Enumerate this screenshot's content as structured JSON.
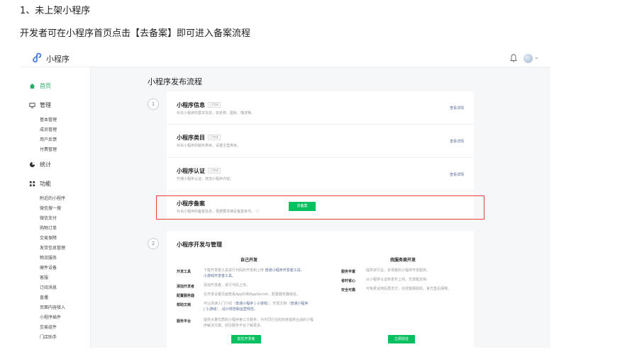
{
  "doc": {
    "heading": "1、未上架小程序",
    "line": "开发者可在小程序首页点击【去备案】即可进入备案流程"
  },
  "app": {
    "title": "小程序"
  },
  "sidebar": {
    "home": "首页",
    "manage": "管理",
    "manage_items": [
      "基本管理",
      "成员管理",
      "用户反馈",
      "付费管理"
    ],
    "stats": "统计",
    "features": "功能",
    "feature_items": [
      "附近的小程序",
      "微信搜一搜",
      "微信支付",
      "购物订单",
      "交易保障",
      "发货信息管理",
      "物流服务",
      "硬件设备",
      "客服",
      "订阅消息",
      "直播",
      "页面内容接入",
      "小程序插件",
      "交易组件",
      "门店助手"
    ]
  },
  "main": {
    "title": "小程序发布流程",
    "step1": "1",
    "step2": "2",
    "rows": [
      {
        "title": "小程序信息",
        "badge": "已完成",
        "desc": "补充小程序的基本信息，如名称、图标、描述等。",
        "link": "查看详情"
      },
      {
        "title": "小程序类目",
        "badge": "已完成",
        "desc": "补充小程序的服务类目，设置主营类目。",
        "link": "查看详情"
      },
      {
        "title": "小程序认证",
        "badge": "已完成",
        "desc": "开通小程序认证，增加小程序内容。",
        "link": "查看详情"
      },
      {
        "title": "小程序备案",
        "desc": "补充小程序的备案信息，根据要求满足备案条件。 ⓘ",
        "button": "去备案"
      }
    ],
    "dev": {
      "title": "小程序开发与管理",
      "left_head": "自己开发",
      "right_head": "找服务商开发",
      "left": [
        {
          "k": "开发工具",
          "v1": "下载开发者工具进行代码的开发和上传 ",
          "v1_link": "普通小程序开发者工具、",
          "v2_link": "小游戏开发者工具。"
        },
        {
          "k": "添加开发者",
          "v1": "添加开发者，进行代码上传。"
        },
        {
          "k": "配置服务器",
          "v1": "在开发设置页面查看AppID和AppSecret，配置服务器域名。"
        },
        {
          "k": "帮助文档",
          "v1": "可以阅读入门介绍（",
          "v1_link": "普通小程序 | 小游戏",
          "v1_tail": "）、开发文档（",
          "v1_link2": "普通小程序",
          "v2_link": "| 小游戏",
          "v2": "）、",
          "v2_link2": "设计规范和运营规范。"
        },
        {
          "k": "服务平台",
          "v1": "提供大量优质的小程序第三方服务，为不同行业的商家提供合适的小程",
          "v2": "序解决方案。前往服务平台了解更多。"
        }
      ],
      "right": [
        {
          "k": "服务丰富",
          "v": "提供多行业、多场景的小程序开发服务。"
        },
        {
          "k": "省时省心",
          "v": "从小程序认证到发布上线，交流程支持。"
        },
        {
          "k": "安全可靠",
          "v": "可免费试用后再支付，在线客服助的，官方售后保障。"
        }
      ],
      "left_button": "前往开发者",
      "right_button": "立即前往"
    }
  },
  "colors": {
    "accent": "#07c160",
    "highlight": "#e8413a",
    "link": "#576b95"
  }
}
